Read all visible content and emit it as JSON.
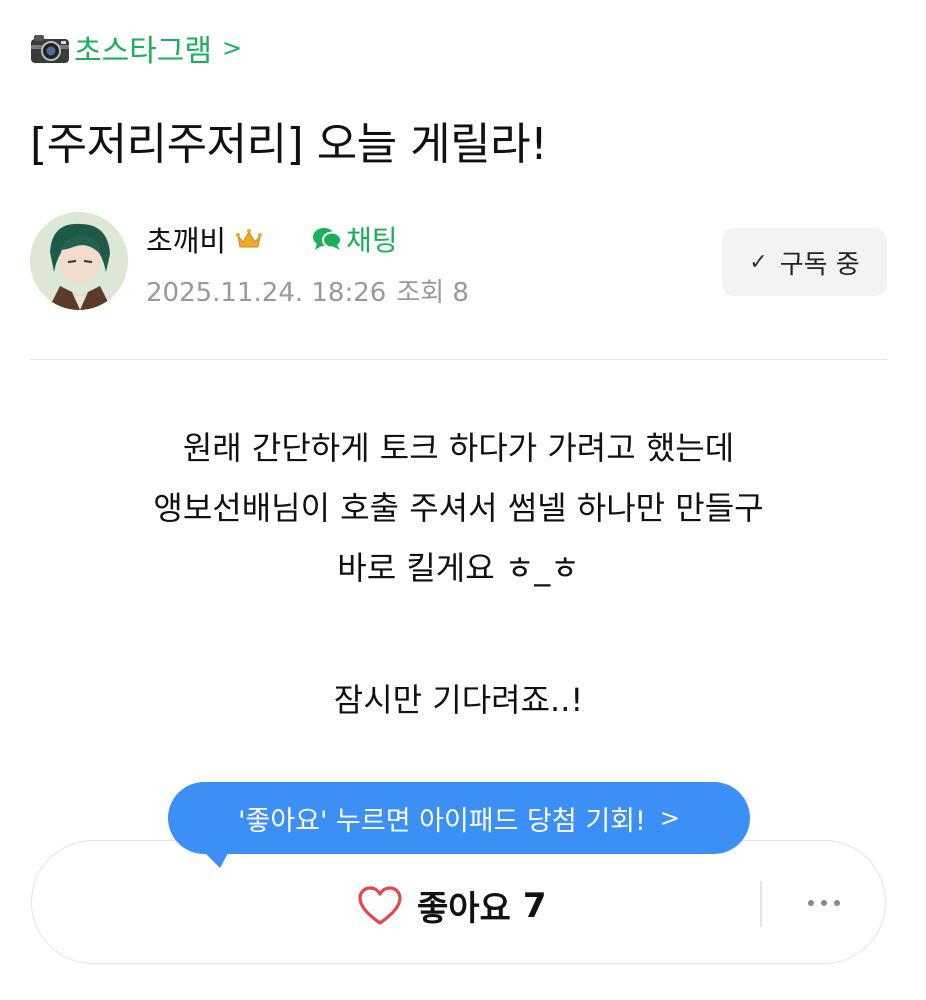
{
  "board": {
    "name": "초스타그램",
    "icon": "camera-icon"
  },
  "post": {
    "title": "[주저리주저리] 오늘 게릴라!",
    "author": {
      "name": "초깨비",
      "badge": "crown-icon"
    },
    "chat_label": "채팅",
    "date": "2025.11.24. 18:26",
    "views_label": "조회 8"
  },
  "subscribe": {
    "label": "구독 중",
    "icon": "check-icon"
  },
  "content": {
    "lines": [
      "원래 간단하게 토크 하다가 가려고 했는데",
      "앵보선배님이 호출 주셔서 썸넬 하나만 만들구",
      "바로 킬게요 ㅎ_ㅎ",
      "잠시만 기다려죠..!"
    ]
  },
  "promo": {
    "text": "'좋아요' 누르면 아이패드 당첨 기회!"
  },
  "like": {
    "label": "좋아요",
    "count": "7"
  },
  "colors": {
    "brand_green": "#1ab05a",
    "bubble_blue": "#3b8ff5",
    "heart_red": "#e2474b"
  }
}
